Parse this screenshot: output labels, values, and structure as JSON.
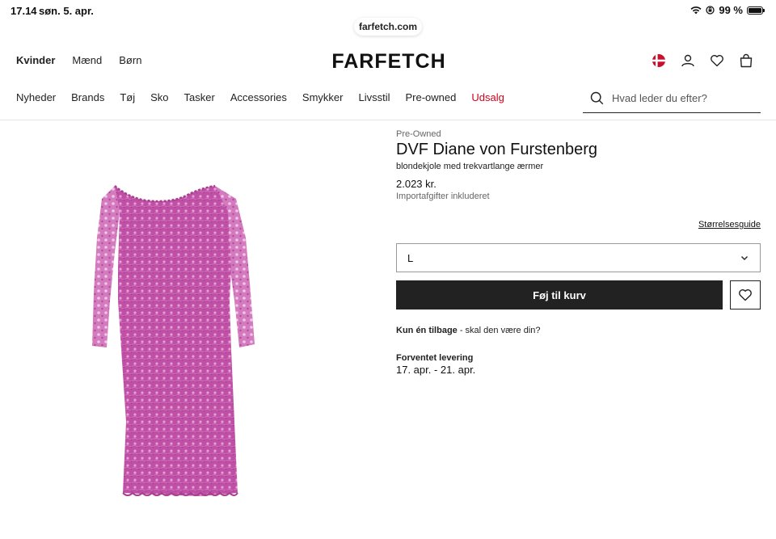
{
  "status": {
    "time": "17.14",
    "date": "søn. 5. apr.",
    "battery": "99 %",
    "battery_level": 0.99
  },
  "browser": {
    "url": "farfetch.com"
  },
  "header": {
    "logo": "FARFETCH",
    "gender_nav": [
      "Kvinder",
      "Mænd",
      "Børn"
    ],
    "categories": [
      "Nyheder",
      "Brands",
      "Tøj",
      "Sko",
      "Tasker",
      "Accessories",
      "Smykker",
      "Livsstil",
      "Pre-owned",
      "Udsalg"
    ],
    "search_placeholder": "Hvad leder du efter?"
  },
  "product": {
    "tag": "Pre-Owned",
    "brand": "DVF Diane von Furstenberg",
    "description": "blondekjole med trekvartlange ærmer",
    "price": "2.023 kr.",
    "duties": "Importafgifter inkluderet",
    "size_guide": "Størrelsesguide",
    "selected_size": "L",
    "add_to_bag": "Føj til kurv",
    "stock_bold": "Kun én tilbage",
    "stock_rest": " - skal den være din?",
    "delivery_label": "Forventet levering",
    "delivery_dates": "17. apr. - 21. apr.",
    "dress_color": "#c04fa6"
  },
  "colors": {
    "sale": "#d0021b",
    "button": "#222222"
  }
}
